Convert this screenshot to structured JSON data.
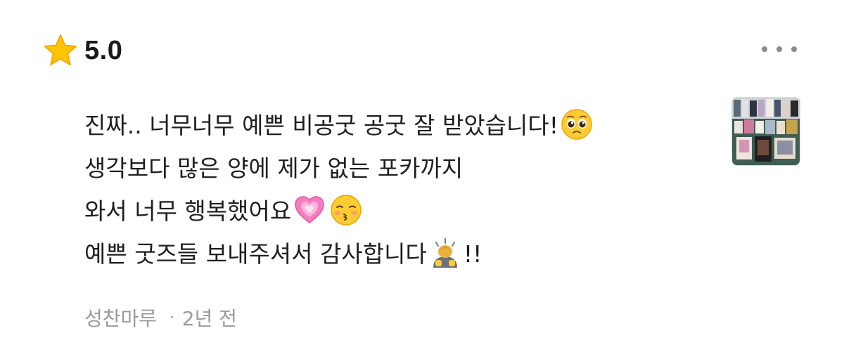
{
  "review": {
    "rating_value": "5.0",
    "rating_icon": "star-icon",
    "star_color": "#FFC400",
    "more_icon": "more-horizontal-icon",
    "lines": [
      {
        "text": "진짜.. 너무너무 예쁜 비공굿 공굿 잘 받았습니다!",
        "trailing_emoji": "pleading-face-emoji"
      },
      {
        "text": "생각보다 많은 양에 제가 없는 포카까지"
      },
      {
        "text_before": "와서 너무 행복했어요",
        "emojis": [
          "growing-heart-emoji",
          "kissing-face-emoji"
        ]
      },
      {
        "text_before": "예쁜 굿즈들 보내주셔서 감사합니다",
        "emoji": "bowing-person-emoji",
        "text_after": "!!"
      }
    ],
    "photo": "review-photo-thumbnail",
    "author": "성찬마루",
    "separator": "·",
    "time_ago": "2년 전"
  }
}
